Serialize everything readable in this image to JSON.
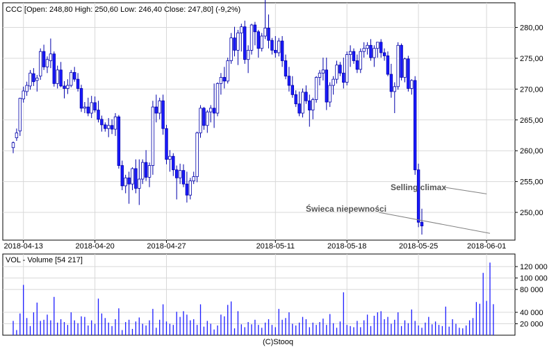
{
  "header": {
    "price_label": "CCC [Open: 248,80  High: 250,60  Low: 246,40  Close: 247,80] (-9,2%)",
    "volume_label": "VOL - Volume [54 217]",
    "footer": "(C)Stooq"
  },
  "colors": {
    "bull_body": "#ffffff",
    "bear_body": "#1a1aff",
    "candle_outline": "#0000aa",
    "grid": "#d8d8d8",
    "frame": "#000000",
    "annotation_line": "#808080"
  },
  "chart_data": [
    {
      "type": "candlestick",
      "title": "CCC [Open: 248,80  High: 250,60  Low: 246,40  Close: 247,80] (-9,2%)",
      "ylim": [
        245.5,
        284
      ],
      "yticks": [
        250,
        255,
        260,
        265,
        270,
        275,
        280
      ],
      "ytick_labels": [
        "250,00",
        "255,00",
        "260,00",
        "265,00",
        "270,00",
        "275,00",
        "280,00"
      ],
      "xticks": [
        {
          "index": 3,
          "label": "2018-04-13"
        },
        {
          "index": 24,
          "label": "2018-04-20"
        },
        {
          "index": 45,
          "label": "2018-04-27"
        },
        {
          "index": 77,
          "label": "2018-05-11"
        },
        {
          "index": 98,
          "label": "2018-05-18"
        },
        {
          "index": 119,
          "label": "2018-05-25"
        },
        {
          "index": 139,
          "label": "2018-06-01"
        }
      ],
      "grid": true,
      "ohlc": [
        [
          260.5,
          261.5,
          259.6,
          261.3
        ],
        [
          262.1,
          263.6,
          261.6,
          262.9
        ],
        [
          263.2,
          268.6,
          262.4,
          268.5
        ],
        [
          268.4,
          270.4,
          267.8,
          269.7
        ],
        [
          269.6,
          271.2,
          268.9,
          270.6
        ],
        [
          270.5,
          273.1,
          269.9,
          272.6
        ],
        [
          272.5,
          273.4,
          270.5,
          271.2
        ],
        [
          271.4,
          272.3,
          269.6,
          271.8
        ],
        [
          272.1,
          276.6,
          271.5,
          276.1
        ],
        [
          276.1,
          277.2,
          273.1,
          273.6
        ],
        [
          273.6,
          275.3,
          272.6,
          274.8
        ],
        [
          274.6,
          278.2,
          273.4,
          275.7
        ],
        [
          275.7,
          276.1,
          270.4,
          270.9
        ],
        [
          270.9,
          273.8,
          270.1,
          273.1
        ],
        [
          273.1,
          274.4,
          270.3,
          270.5
        ],
        [
          270.5,
          271.3,
          268.5,
          270.1
        ],
        [
          270.1,
          271.6,
          269.2,
          270.6
        ],
        [
          270.6,
          273.1,
          270.3,
          272.7
        ],
        [
          272.7,
          273.6,
          271.2,
          271.6
        ],
        [
          271.6,
          272.6,
          269.6,
          270.1
        ],
        [
          270.1,
          270.7,
          266.3,
          266.9
        ],
        [
          266.9,
          267.9,
          266.1,
          267.1
        ],
        [
          267.1,
          268.6,
          265.6,
          266.1
        ],
        [
          266.1,
          268.9,
          265.3,
          267.8
        ],
        [
          267.8,
          268.8,
          266.2,
          266.6
        ],
        [
          266.6,
          268.1,
          264.6,
          265.1
        ],
        [
          265.1,
          265.7,
          263.1,
          264.2
        ],
        [
          264.2,
          264.6,
          263.1,
          263.6
        ],
        [
          263.6,
          265.3,
          262.2,
          264.1
        ],
        [
          264.1,
          265.1,
          262.7,
          263.5
        ],
        [
          263.5,
          266.1,
          262.4,
          265.5
        ],
        [
          265.5,
          265.8,
          257.1,
          257.6
        ],
        [
          257.6,
          258.4,
          253.6,
          254.3
        ],
        [
          254.3,
          256.1,
          253.1,
          255.6
        ],
        [
          255.6,
          256.6,
          251.4,
          254.6
        ],
        [
          254.6,
          257.3,
          253.6,
          257.1
        ],
        [
          257.1,
          258.6,
          253.1,
          253.9
        ],
        [
          253.9,
          258.6,
          251.2,
          255.4
        ],
        [
          255.4,
          258.6,
          254.6,
          258.1
        ],
        [
          258.1,
          260.1,
          255.1,
          255.7
        ],
        [
          255.7,
          258.1,
          254.1,
          257.6
        ],
        [
          257.6,
          268.1,
          256.1,
          267.1
        ],
        [
          267.1,
          269.1,
          264.6,
          266.1
        ],
        [
          266.1,
          268.6,
          265.1,
          268.1
        ],
        [
          268.1,
          269.1,
          262.6,
          263.6
        ],
        [
          263.6,
          264.2,
          257.8,
          258.6
        ],
        [
          258.6,
          260.1,
          256.6,
          259.1
        ],
        [
          259.1,
          259.6,
          255.9,
          256.9
        ],
        [
          256.9,
          257.6,
          252.1,
          255.6
        ],
        [
          255.6,
          257.9,
          254.6,
          256.8
        ],
        [
          256.8,
          257.8,
          254.1,
          254.6
        ],
        [
          254.6,
          256.6,
          251.6,
          252.8
        ],
        [
          252.8,
          255.6,
          252.1,
          255.1
        ],
        [
          255.1,
          256.6,
          254.6,
          255.8
        ],
        [
          255.8,
          263.1,
          254.9,
          262.9
        ],
        [
          262.9,
          267.4,
          262.1,
          266.9
        ],
        [
          266.9,
          267.1,
          263.4,
          264.1
        ],
        [
          264.1,
          266.6,
          262.9,
          266.3
        ],
        [
          266.3,
          267.4,
          264.6,
          266.9
        ],
        [
          266.9,
          270.9,
          263.7,
          266.1
        ],
        [
          266.1,
          271.1,
          265.6,
          270.9
        ],
        [
          270.9,
          272.6,
          269.1,
          271.9
        ],
        [
          271.9,
          273.6,
          270.1,
          271.3
        ],
        [
          271.3,
          275.1,
          270.9,
          274.6
        ],
        [
          274.6,
          279.1,
          274.1,
          278.3
        ],
        [
          278.3,
          280.1,
          275.3,
          276.3
        ],
        [
          276.3,
          279.6,
          273.9,
          279.1
        ],
        [
          279.1,
          280.6,
          276.1,
          280.1
        ],
        [
          280.1,
          281.1,
          274.1,
          274.8
        ],
        [
          274.8,
          277.1,
          272.6,
          276.3
        ],
        [
          276.3,
          280.6,
          275.6,
          280.4
        ],
        [
          280.4,
          280.9,
          277.1,
          279.3
        ],
        [
          279.3,
          279.6,
          275.1,
          276.6
        ],
        [
          276.6,
          279.1,
          276.1,
          278.6
        ],
        [
          278.6,
          284.6,
          278.1,
          279.9
        ],
        [
          279.9,
          282.1,
          276.6,
          277.9
        ],
        [
          277.9,
          278.3,
          275.6,
          276.3
        ],
        [
          276.3,
          278.6,
          275.1,
          275.9
        ],
        [
          275.9,
          278.3,
          275.3,
          277.8
        ],
        [
          277.8,
          278.6,
          273.6,
          274.6
        ],
        [
          274.6,
          275.6,
          271.6,
          272.1
        ],
        [
          272.1,
          273.6,
          269.6,
          270.6
        ],
        [
          270.6,
          272.1,
          268.6,
          269.1
        ],
        [
          269.1,
          269.8,
          267.1,
          267.6
        ],
        [
          267.6,
          269.6,
          265.6,
          266.1
        ],
        [
          266.1,
          270.1,
          265.4,
          269.5
        ],
        [
          269.5,
          270.6,
          267.6,
          268.1
        ],
        [
          268.1,
          269.1,
          263.9,
          266.6
        ],
        [
          266.6,
          268.6,
          265.1,
          268.3
        ],
        [
          268.3,
          272.1,
          267.8,
          271.9
        ],
        [
          271.9,
          273.1,
          270.6,
          272.6
        ],
        [
          272.6,
          275.1,
          271.4,
          273.1
        ],
        [
          273.1,
          275.1,
          266.6,
          267.9
        ],
        [
          267.9,
          271.1,
          267.1,
          270.6
        ],
        [
          270.6,
          272.1,
          269.1,
          271.6
        ],
        [
          271.6,
          274.6,
          270.9,
          273.9
        ],
        [
          273.9,
          274.4,
          272.1,
          272.6
        ],
        [
          272.6,
          275.1,
          270.1,
          271.1
        ],
        [
          271.1,
          276.1,
          270.6,
          275.6
        ],
        [
          275.6,
          277.1,
          273.6,
          276.1
        ],
        [
          276.1,
          276.6,
          274.1,
          274.6
        ],
        [
          274.6,
          275.6,
          272.6,
          273.2
        ],
        [
          273.2,
          276.6,
          272.6,
          276.1
        ],
        [
          276.1,
          277.6,
          275.1,
          276.6
        ],
        [
          276.6,
          277.6,
          275.6,
          277.1
        ],
        [
          277.1,
          278.1,
          274.6,
          275.1
        ],
        [
          275.1,
          277.1,
          273.6,
          276.6
        ],
        [
          276.6,
          277.6,
          275.1,
          277.6
        ],
        [
          277.6,
          278.1,
          275.1,
          275.9
        ],
        [
          275.9,
          276.6,
          274.6,
          275.4
        ],
        [
          275.4,
          276.1,
          272.1,
          272.4
        ],
        [
          272.4,
          274.1,
          268.6,
          269.6
        ],
        [
          269.6,
          271.1,
          266.1,
          270.4
        ],
        [
          270.4,
          277.6,
          269.9,
          277.1
        ],
        [
          277.1,
          277.4,
          271.4,
          271.9
        ],
        [
          271.9,
          275.1,
          271.1,
          274.9
        ],
        [
          274.9,
          275.4,
          269.6,
          270.1
        ],
        [
          270.1,
          271.6,
          269.1,
          271.4
        ],
        [
          271.4,
          272.1,
          256.1,
          256.9
        ],
        [
          256.9,
          257.9,
          247.6,
          248.4
        ],
        [
          248.4,
          250.6,
          246.4,
          247.8
        ]
      ]
    },
    {
      "type": "bar",
      "title": "VOL - Volume [54 217]",
      "ylim": [
        0,
        142000
      ],
      "yticks": [
        20000,
        40000,
        80000,
        100000,
        120000
      ],
      "ytick_labels": [
        "20 000",
        "40 000",
        "80 000",
        "100 000",
        "120 000"
      ],
      "values": [
        25000,
        9000,
        38000,
        88000,
        30000,
        16000,
        40000,
        57000,
        25000,
        27000,
        36000,
        26000,
        67000,
        22000,
        28000,
        23000,
        18000,
        40000,
        26000,
        21000,
        33000,
        32000,
        17000,
        26000,
        20000,
        64000,
        38000,
        30000,
        22000,
        16000,
        28000,
        47000,
        9000,
        23000,
        27000,
        11000,
        24000,
        31000,
        20000,
        17000,
        26000,
        46000,
        13000,
        27000,
        54000,
        24000,
        20000,
        18000,
        41000,
        32000,
        42000,
        36000,
        26000,
        28000,
        18000,
        54000,
        15000,
        25000,
        20000,
        10000,
        17000,
        36000,
        33000,
        53000,
        59000,
        12000,
        42000,
        19000,
        14000,
        23000,
        19000,
        27000,
        18000,
        13000,
        22000,
        28000,
        18000,
        14000,
        46000,
        27000,
        30000,
        40000,
        20000,
        17000,
        22000,
        32000,
        28000,
        14000,
        22000,
        18000,
        23000,
        29000,
        18000,
        37000,
        21000,
        13000,
        24000,
        75000,
        18000,
        16000,
        14000,
        25000,
        14000,
        26000,
        36000,
        16000,
        34000,
        40000,
        42000,
        28000,
        32000,
        20000,
        27000,
        40000,
        16000,
        26000,
        21000,
        45000,
        25000,
        17000,
        13000,
        22000,
        32000,
        19000,
        24000,
        18000,
        16000,
        50000,
        15000,
        28000,
        20000,
        13000,
        12000,
        17000,
        26000,
        30000,
        58000,
        55000,
        109000,
        60000,
        127000,
        54217
      ]
    }
  ],
  "annotations": [
    {
      "text": "Selling climax",
      "target_index": 139,
      "target_value": 253.0
    },
    {
      "text": "Świeca niepewności",
      "target_index": 140,
      "target_value": 246.6
    }
  ]
}
